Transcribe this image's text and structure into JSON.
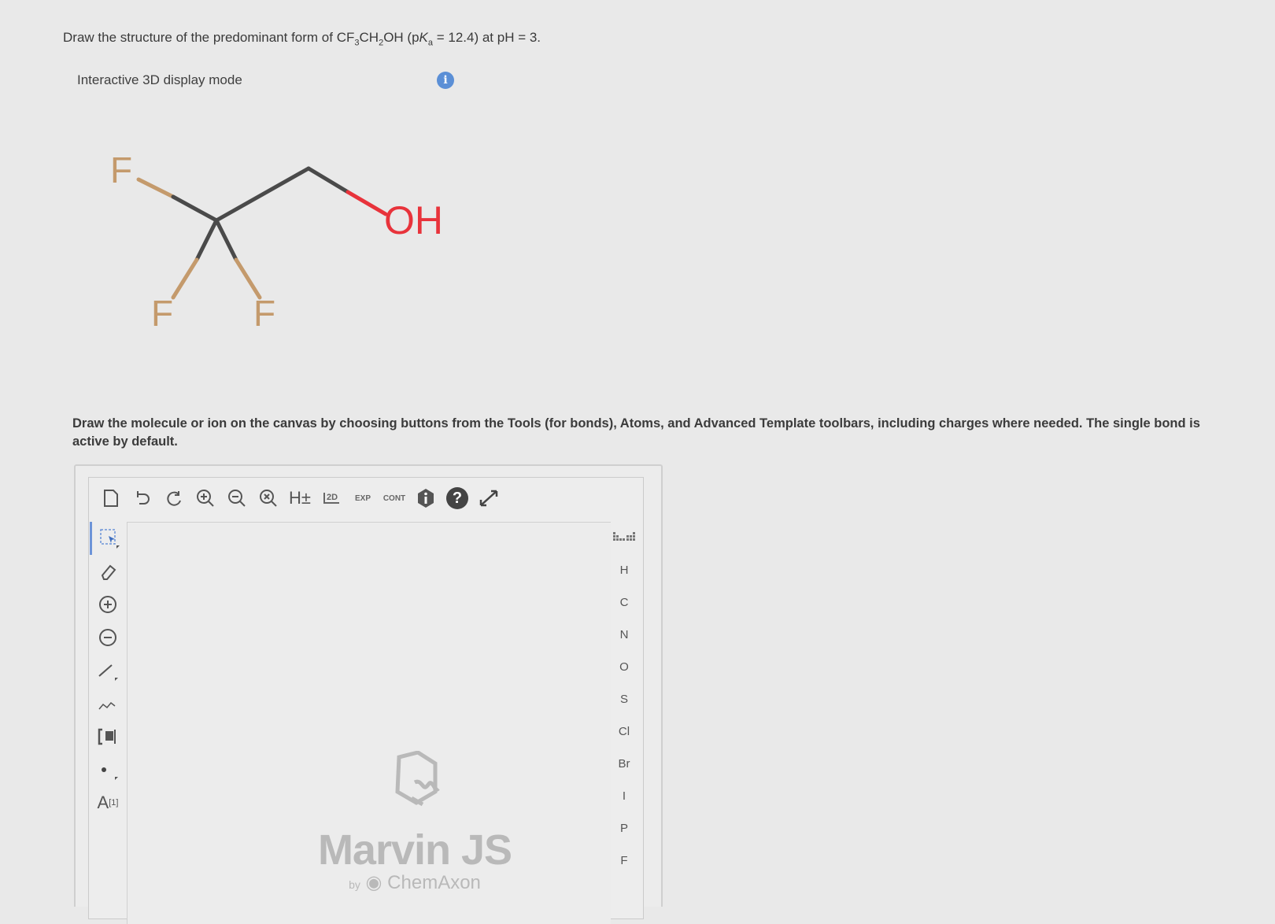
{
  "question": {
    "prefix": "Draw the structure of the predominant form of CF",
    "sub1": "3",
    "mid1": "CH",
    "sub2": "2",
    "mid2": "OH (p",
    "k_letter": "K",
    "sub3": "a",
    "suffix": " = 12.4) at pH = 3."
  },
  "display_mode_label": "Interactive 3D display mode",
  "info_icon_glyph": "i",
  "molecule": {
    "atoms": {
      "f_top": "F",
      "f_left": "F",
      "f_right": "F",
      "oh": "OH"
    },
    "colors": {
      "carbon": "#4a4a4a",
      "fluorine": "#c49a6c",
      "oxygen": "#e8333b"
    }
  },
  "instructions": "Draw the molecule or ion on the canvas by choosing buttons from the Tools (for bonds), Atoms, and Advanced Template toolbars, including charges where needed. The single bond is active by default.",
  "toolbar": {
    "h_toggle": "H±",
    "clean2d": "2D",
    "expand": "EXP",
    "contract": "CONT",
    "help": "?"
  },
  "left_tools": {
    "atom_label_tool": "A",
    "atom_label_sup": "[1]"
  },
  "atoms_toolbar": [
    "H",
    "C",
    "N",
    "O",
    "S",
    "Cl",
    "Br",
    "I",
    "P",
    "F"
  ],
  "watermark": {
    "title": "Marvin JS",
    "by": "by",
    "company": "ChemAxon"
  }
}
